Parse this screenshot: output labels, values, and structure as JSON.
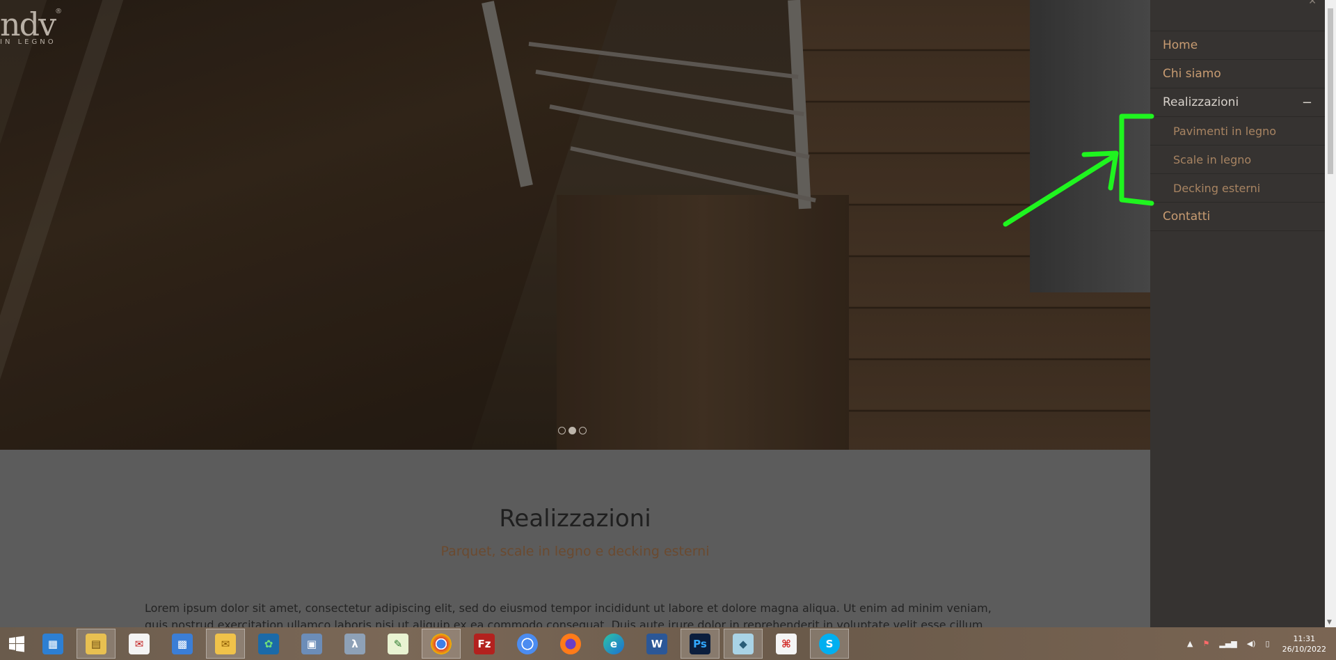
{
  "logo": {
    "mark": "ndv",
    "registered": "®",
    "subtitle": "IN LEGNO"
  },
  "hero": {
    "slides": 3,
    "active_slide": 2
  },
  "content": {
    "title": "Realizzazioni",
    "subtitle": "Parquet, scale in legno e decking esterni",
    "body": "Lorem ipsum dolor sit amet, consectetur adipiscing elit, sed do eiusmod tempor incididunt ut labore et dolore magna aliqua. Ut enim ad minim veniam, quis nostrud exercitation ullamco laboris nisi ut aliquip ex ea commodo consequat. Duis aute irure dolor in reprehenderit in voluptate velit esse cillum dolore eu"
  },
  "menu": {
    "items": [
      {
        "label": "Home"
      },
      {
        "label": "Chi siamo"
      },
      {
        "label": "Realizzazioni",
        "toggle": "−"
      },
      {
        "label": "Pavimenti in legno"
      },
      {
        "label": "Scale in legno"
      },
      {
        "label": "Decking esterni"
      },
      {
        "label": "Contatti"
      }
    ]
  },
  "taskbar": {
    "apps": [
      "windows-start",
      "remote-desktop",
      "file-explorer",
      "mail-client",
      "calculator",
      "outlook",
      "butterfly-app",
      "network-app",
      "lambda-app",
      "notepad-plus",
      "chrome",
      "filezilla",
      "chromium",
      "firefox",
      "edge",
      "word",
      "photoshop",
      "sticky-app",
      "acrobat",
      "skype"
    ],
    "time": "11:31",
    "date": "26/10/2022"
  },
  "colors": {
    "accent": "#c89c72",
    "annotation": "#1ff51f",
    "menu_bg": "#363331"
  }
}
